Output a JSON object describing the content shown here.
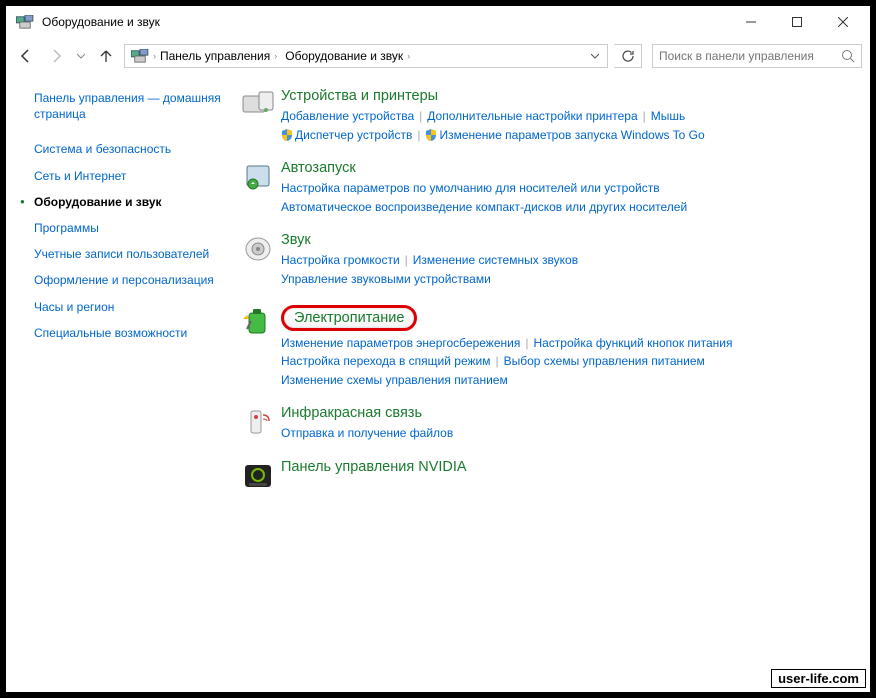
{
  "window": {
    "title": "Оборудование и звук"
  },
  "breadcrumb": {
    "root": "Панель управления",
    "current": "Оборудование и звук"
  },
  "search": {
    "placeholder": "Поиск в панели управления"
  },
  "sidebar": {
    "home": "Панель управления — домашняя страница",
    "items": [
      "Система и безопасность",
      "Сеть и Интернет",
      "Оборудование и звук",
      "Программы",
      "Учетные записи пользователей",
      "Оформление и персонализация",
      "Часы и регион",
      "Специальные возможности"
    ],
    "current_index": 2
  },
  "groups": [
    {
      "title": "Устройства и принтеры",
      "links": [
        "Добавление устройства",
        "Дополнительные настройки принтера",
        "Мышь"
      ],
      "links2": [
        "Диспетчер устройств",
        "Изменение параметров запуска Windows To Go"
      ],
      "shield2": [
        true,
        true
      ]
    },
    {
      "title": "Автозапуск",
      "links": [
        "Настройка параметров по умолчанию для носителей или устройств"
      ],
      "links2": [
        "Автоматическое воспроизведение компакт-дисков или других носителей"
      ]
    },
    {
      "title": "Звук",
      "links": [
        "Настройка громкости",
        "Изменение системных звуков"
      ],
      "links2": [
        "Управление звуковыми устройствами"
      ]
    },
    {
      "title": "Электропитание",
      "highlighted": true,
      "links": [
        "Изменение параметров энергосбережения",
        "Настройка функций кнопок питания"
      ],
      "links2": [
        "Настройка перехода в спящий режим",
        "Выбор схемы управления питанием"
      ],
      "links3": [
        "Изменение схемы управления питанием"
      ]
    },
    {
      "title": "Инфракрасная связь",
      "links": [
        "Отправка и получение файлов"
      ]
    },
    {
      "title": "Панель управления NVIDIA",
      "links": []
    }
  ],
  "watermark": "user-life.com"
}
